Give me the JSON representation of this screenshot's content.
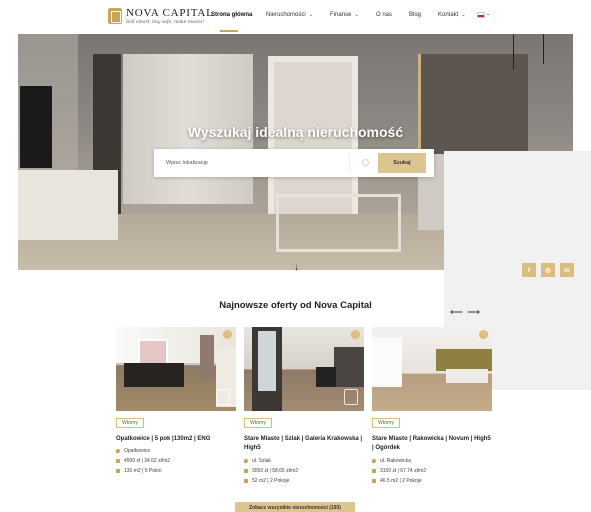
{
  "header": {
    "logo_name": "NOVA CAPITAL",
    "logo_tagline": "Sell smart, buy safe, make moves!",
    "nav": [
      {
        "label": "Strona główna",
        "active": true,
        "dropdown": false
      },
      {
        "label": "Nieruchomości",
        "active": false,
        "dropdown": true
      },
      {
        "label": "Finanse",
        "active": false,
        "dropdown": true
      },
      {
        "label": "O nas",
        "active": false,
        "dropdown": false
      },
      {
        "label": "Blog",
        "active": false,
        "dropdown": false
      },
      {
        "label": "Kontakt",
        "active": false,
        "dropdown": true
      }
    ],
    "language": "PL"
  },
  "hero": {
    "title": "Wyszukaj idealną nieruchomość",
    "search_placeholder": "Wpisz lokalizację",
    "search_button": "Szukaj"
  },
  "social": [
    "facebook-icon",
    "instagram-icon",
    "linkedin-icon"
  ],
  "section_title": "Najnowsze oferty od Nova Capital",
  "listings": [
    {
      "badge": "Wtórny",
      "title": "Opatkowice | 5 pok |130m2 | ENG",
      "location": "Opatkowice",
      "price": "4500 zł | 34.62 zł/m2",
      "size": "130 m2 | 5 Pokoi"
    },
    {
      "badge": "Wtórny",
      "title": "Stare Miasto | Szlak | Galeria Krakowska | High5",
      "location": "ul. Szlak",
      "price": "3050 zł | 58.65 zł/m2",
      "size": "52 m2 | 2 Pokoje"
    },
    {
      "badge": "Wtórny",
      "title": "Stare Miasto | Rakowicka | Novum | High5 | Ogórdek",
      "location": "ul. Rakowicka",
      "price": "3150 zł | 67.74 zł/m2",
      "size": "46.5 m2 | 2 Pokoje"
    }
  ],
  "all_button": "Zobacz wszystkie nieruchomości (193)",
  "colors": {
    "accent": "#dcc58e",
    "gold": "#c8a45c"
  }
}
